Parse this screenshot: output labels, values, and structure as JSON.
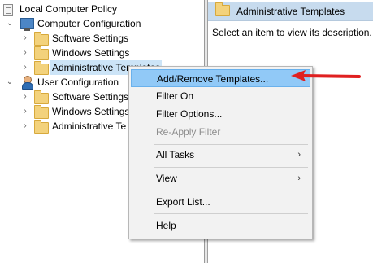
{
  "tree": {
    "root_label": "Local Computer Policy",
    "computer_config": {
      "label": "Computer Configuration",
      "children": [
        "Software Settings",
        "Windows Settings",
        "Administrative Templates"
      ]
    },
    "user_config": {
      "label": "User Configuration",
      "children": [
        "Software Settings",
        "Windows Settings",
        "Administrative Te"
      ]
    }
  },
  "right_pane": {
    "header_title": "Administrative Templates",
    "description": "Select an item to view its description."
  },
  "context_menu": {
    "items": [
      {
        "label": "Add/Remove Templates...",
        "state": "highlighted"
      },
      {
        "label": "Filter On"
      },
      {
        "label": "Filter Options..."
      },
      {
        "label": "Re-Apply Filter",
        "state": "disabled"
      },
      {
        "label": "All Tasks",
        "submenu": true
      },
      {
        "label": "View",
        "submenu": true
      },
      {
        "label": "Export List..."
      },
      {
        "label": "Help"
      }
    ]
  },
  "colors": {
    "selection": "#cce4f7",
    "menu_highlight": "#91c9f7",
    "header_bg": "#c7dbee",
    "annotation_arrow": "#e02020"
  }
}
